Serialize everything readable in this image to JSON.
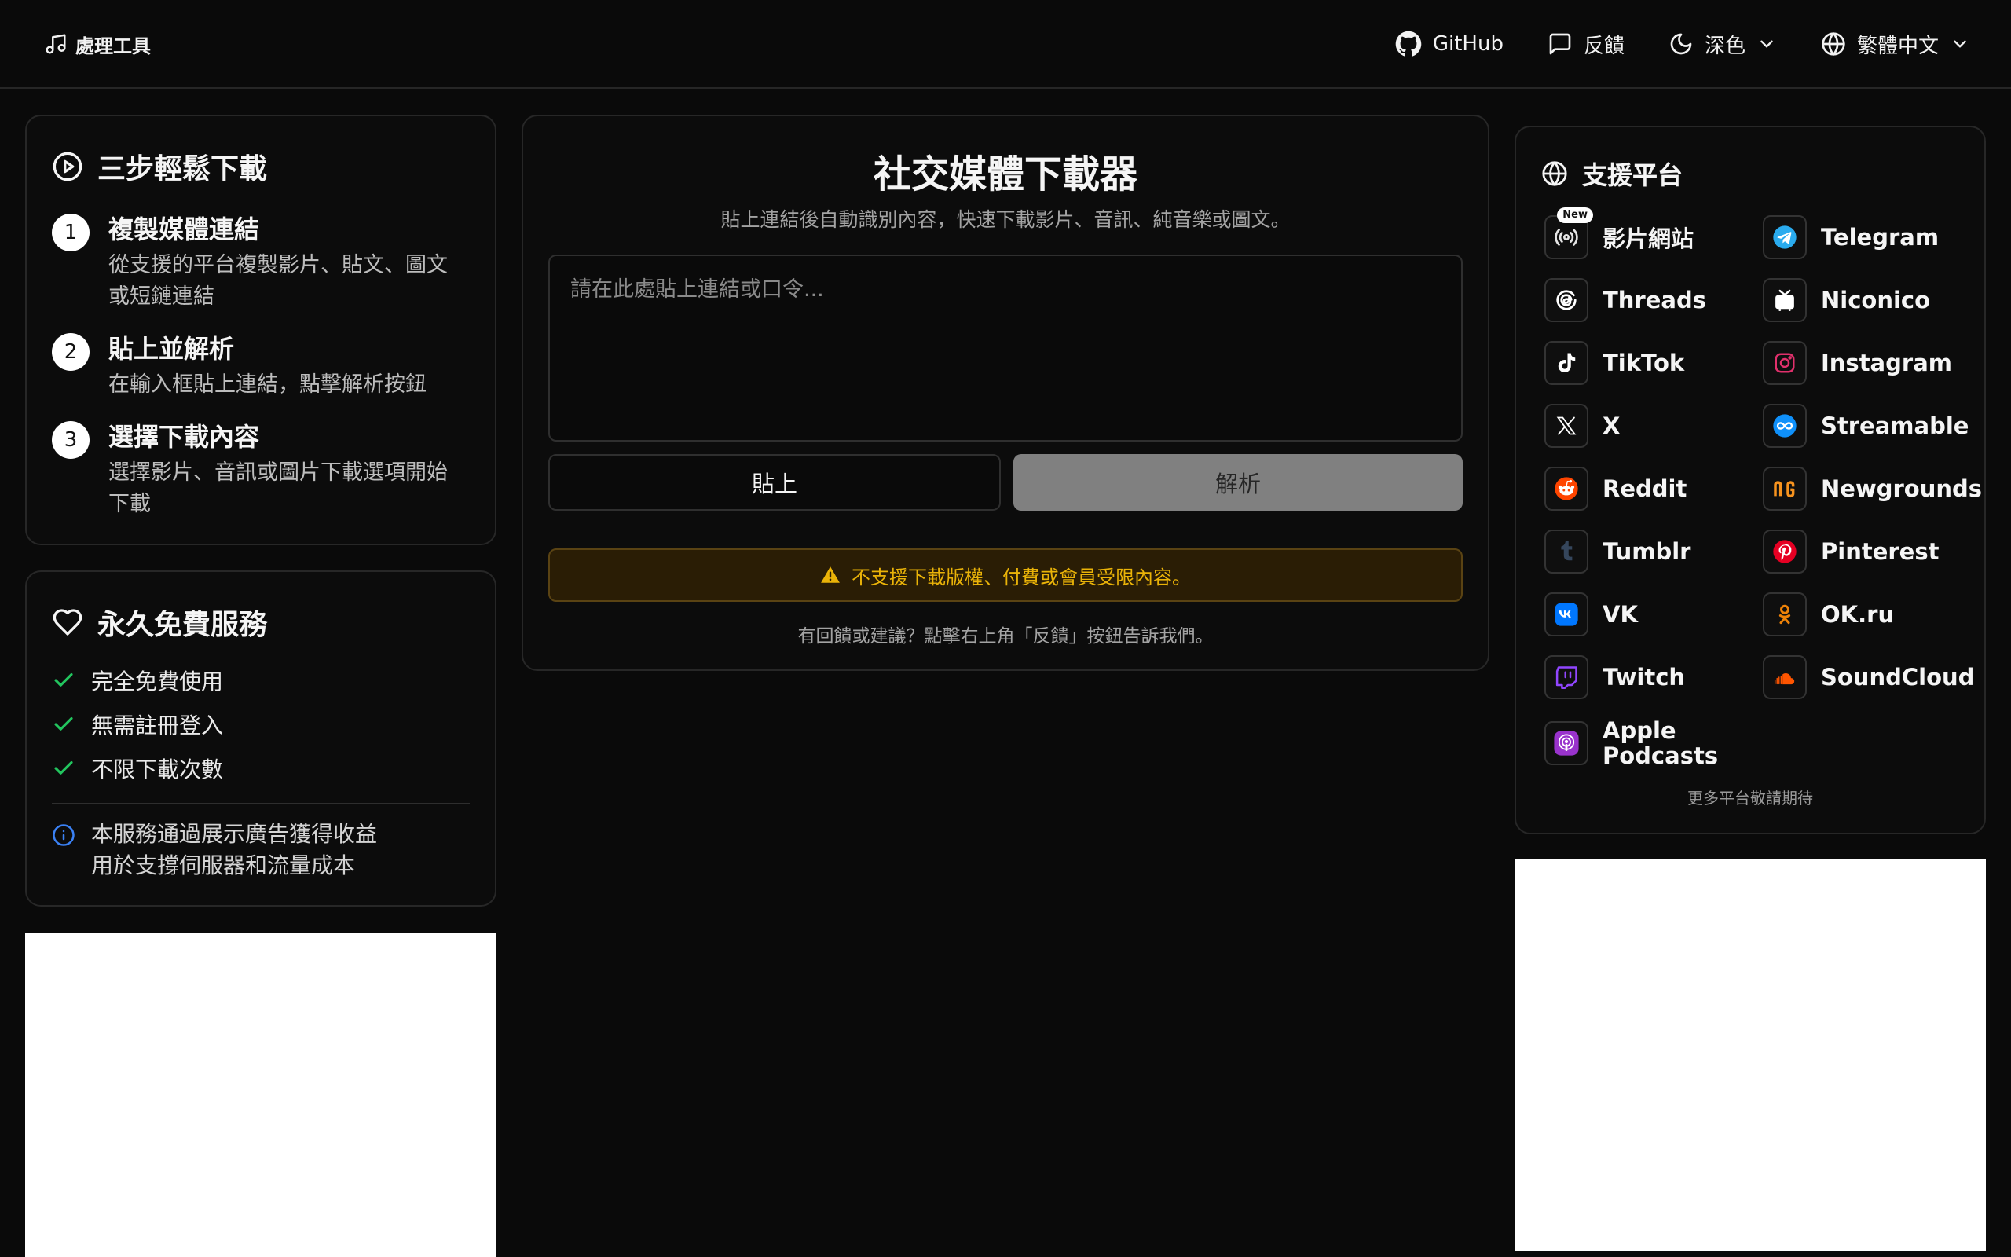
{
  "header": {
    "brand": "處理工具",
    "github": "GitHub",
    "feedback": "反饋",
    "theme": "深色",
    "language": "繁體中文"
  },
  "steps": {
    "title": "三步輕鬆下載",
    "items": [
      {
        "num": "1",
        "title": "複製媒體連結",
        "desc_lines": [
          "從支援的平台複製影片、貼文、圖文",
          "或短鏈連結"
        ]
      },
      {
        "num": "2",
        "title": "貼上並解析",
        "desc_lines": [
          "在輸入框貼上連結，點擊解析按鈕"
        ]
      },
      {
        "num": "3",
        "title": "選擇下載內容",
        "desc_lines": [
          "選擇影片、音訊或圖片下載選項開始",
          "下載"
        ]
      }
    ]
  },
  "free": {
    "title": "永久免費服務",
    "items": [
      "完全免費使用",
      "無需註冊登入",
      "不限下載次數"
    ],
    "info_lines": [
      "本服務通過展示廣告獲得收益",
      "用於支撐伺服器和流量成本"
    ]
  },
  "main": {
    "title": "社交媒體下載器",
    "subtitle": "貼上連結後自動識別內容，快速下載影片、音訊、純音樂或圖文。",
    "input_placeholder": "請在此處貼上連結或口令...",
    "paste_label": "貼上",
    "parse_label": "解析",
    "warning": "不支援下載版權、付費或會員受限內容。",
    "feedback_note": "有回饋或建議？點擊右上角「反饋」按鈕告訴我們。"
  },
  "platforms": {
    "title": "支援平台",
    "new_badge": "New",
    "left": [
      {
        "name": "影片網站",
        "icon": "broadcast-icon",
        "color": "#e5e5e5"
      },
      {
        "name": "Threads",
        "icon": "threads-icon",
        "color": "#ffffff"
      },
      {
        "name": "TikTok",
        "icon": "tiktok-icon",
        "color": "#ffffff"
      },
      {
        "name": "X",
        "icon": "x-icon",
        "color": "#ffffff"
      },
      {
        "name": "Reddit",
        "icon": "reddit-icon",
        "color": "#ff4500"
      },
      {
        "name": "Tumblr",
        "icon": "tumblr-icon",
        "color": "#35465c"
      },
      {
        "name": "VK",
        "icon": "vk-icon",
        "color": "#0077ff"
      },
      {
        "name": "Twitch",
        "icon": "twitch-icon",
        "color": "#9146ff"
      },
      {
        "name_lines": [
          "Apple",
          "Podcasts"
        ],
        "icon": "podcasts-icon",
        "color": "#9933cc"
      }
    ],
    "right": [
      {
        "name": "Telegram",
        "icon": "telegram-icon",
        "color": "#2aabee"
      },
      {
        "name": "Niconico",
        "icon": "niconico-icon",
        "color": "#ffffff"
      },
      {
        "name": "Instagram",
        "icon": "instagram-icon",
        "color": "#e1306c"
      },
      {
        "name": "Streamable",
        "icon": "streamable-icon",
        "color": "#0f90fa"
      },
      {
        "name": "Newgrounds",
        "icon": "newgrounds-icon",
        "color": "#f7931e"
      },
      {
        "name": "Pinterest",
        "icon": "pinterest-icon",
        "color": "#e60023"
      },
      {
        "name": "OK.ru",
        "icon": "okru-icon",
        "color": "#ee8208"
      },
      {
        "name": "SoundCloud",
        "icon": "soundcloud-icon",
        "color": "#ff5500"
      }
    ],
    "more_note": "更多平台敬請期待"
  }
}
